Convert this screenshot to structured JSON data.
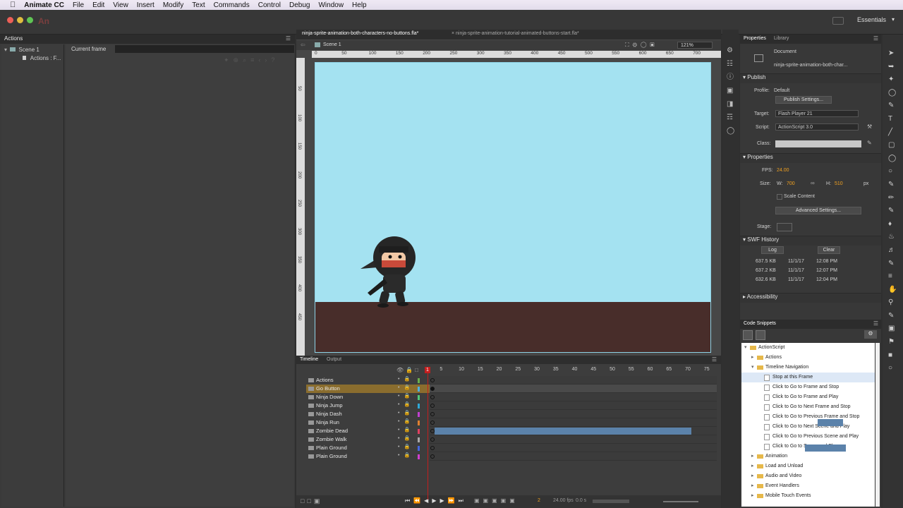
{
  "menubar": {
    "app_name": "Animate CC",
    "items": [
      "File",
      "Edit",
      "View",
      "Insert",
      "Modify",
      "Text",
      "Commands",
      "Control",
      "Debug",
      "Window",
      "Help"
    ]
  },
  "appbar": {
    "logo": "An",
    "workspace": "Essentials"
  },
  "actions_panel": {
    "tab": "Actions",
    "tree": [
      "Scene 1",
      "Actions : F..."
    ],
    "current_frame_label": "Current frame"
  },
  "document": {
    "tabs": [
      "ninja-sprite-animation-both-characters-no-buttons.fla*",
      "ninja-sprite-animation-tutorial-animated-buttons-start.fla*"
    ],
    "scene": "Scene 1",
    "zoom": "121%",
    "ruler_top": [
      "0",
      "50",
      "100",
      "150",
      "200",
      "250",
      "300",
      "350",
      "400",
      "450",
      "500",
      "550",
      "600",
      "650",
      "700"
    ],
    "ruler_left": [
      "50",
      "100",
      "150",
      "200",
      "250",
      "300",
      "350",
      "400",
      "450"
    ]
  },
  "properties": {
    "tabs": [
      "Properties",
      "Library"
    ],
    "doc_type": "Document",
    "doc_name": "ninja-sprite-animation-both-char...",
    "publish": {
      "title": "Publish",
      "profile_label": "Profile:",
      "profile_value": "Default",
      "publish_settings": "Publish Settings...",
      "target_label": "Target:",
      "target_value": "Flash Player 21",
      "script_label": "Script:",
      "script_value": "ActionScript 3.0",
      "class_label": "Class:"
    },
    "props": {
      "title": "Properties",
      "fps_label": "FPS:",
      "fps": "24.00",
      "size_label": "Size:",
      "w_label": "W:",
      "w": "700",
      "h_label": "H:",
      "h": "510",
      "unit": "px",
      "scale_content": "Scale Content",
      "advanced": "Advanced Settings...",
      "stage_label": "Stage:"
    },
    "swf": {
      "title": "SWF History",
      "log": "Log",
      "clear": "Clear",
      "rows": [
        {
          "size": "637.5 KB",
          "date": "11/1/17",
          "time": "12:08 PM"
        },
        {
          "size": "637.2 KB",
          "date": "11/1/17",
          "time": "12:07 PM"
        },
        {
          "size": "632.6 KB",
          "date": "11/1/17",
          "time": "12:04 PM"
        }
      ]
    },
    "accessibility": "Accessibility"
  },
  "snippets": {
    "title": "Code Snippets",
    "items": [
      {
        "label": "ActionScript",
        "indent": 0,
        "type": "folder-open"
      },
      {
        "label": "Actions",
        "indent": 1,
        "type": "folder"
      },
      {
        "label": "Timeline Navigation",
        "indent": 1,
        "type": "folder-open"
      },
      {
        "label": "Stop at this Frame",
        "indent": 2,
        "type": "file"
      },
      {
        "label": "Click to Go to Frame and Stop",
        "indent": 2,
        "type": "file"
      },
      {
        "label": "Click to Go to Frame and Play",
        "indent": 2,
        "type": "file"
      },
      {
        "label": "Click to Go to Next Frame and Stop",
        "indent": 2,
        "type": "file"
      },
      {
        "label": "Click to Go to Previous Frame and Stop",
        "indent": 2,
        "type": "file"
      },
      {
        "label": "Click to Go to Next Scene and Play",
        "indent": 2,
        "type": "file"
      },
      {
        "label": "Click to Go to Previous Scene and Play",
        "indent": 2,
        "type": "file"
      },
      {
        "label": "Click to Go to Scene and Play",
        "indent": 2,
        "type": "file"
      },
      {
        "label": "Animation",
        "indent": 1,
        "type": "folder"
      },
      {
        "label": "Load and Unload",
        "indent": 1,
        "type": "folder"
      },
      {
        "label": "Audio and Video",
        "indent": 1,
        "type": "folder"
      },
      {
        "label": "Event Handlers",
        "indent": 1,
        "type": "folder"
      },
      {
        "label": "Mobile Touch Events",
        "indent": 1,
        "type": "folder"
      }
    ]
  },
  "timeline": {
    "tabs": [
      "Timeline",
      "Output"
    ],
    "ruler": [
      "1",
      "5",
      "10",
      "15",
      "20",
      "25",
      "30",
      "35",
      "40",
      "45",
      "50",
      "55",
      "60",
      "65",
      "70",
      "75"
    ],
    "layers": [
      {
        "name": "Actions",
        "color": "#6ab04c",
        "selected": false
      },
      {
        "name": "Go Button",
        "color": "#4fb0e0",
        "selected": true
      },
      {
        "name": "Ninja Down",
        "color": "#50c878",
        "selected": false
      },
      {
        "name": "Ninja Jump",
        "color": "#2fa8d8",
        "selected": false
      },
      {
        "name": "Ninja Dash",
        "color": "#c040d0",
        "selected": false
      },
      {
        "name": "Ninja Run",
        "color": "#e08030",
        "selected": false
      },
      {
        "name": "Zombie Dead",
        "color": "#e04060",
        "selected": false
      },
      {
        "name": "Zombie Walk",
        "color": "#aaaaaa",
        "selected": false
      },
      {
        "name": "Plain Ground",
        "color": "#4466dd",
        "selected": false
      },
      {
        "name": "Plain Ground",
        "color": "#d040d0",
        "selected": false
      }
    ],
    "current_frame": "2",
    "fps": "24.00 fps",
    "time": "0.0 s"
  },
  "colors": {
    "stage": "#a4e2f1",
    "ground": "#482d2a",
    "tween": "#5b82aa",
    "selected_layer": "#8a6d2e",
    "playhead": "#c41e1e"
  }
}
